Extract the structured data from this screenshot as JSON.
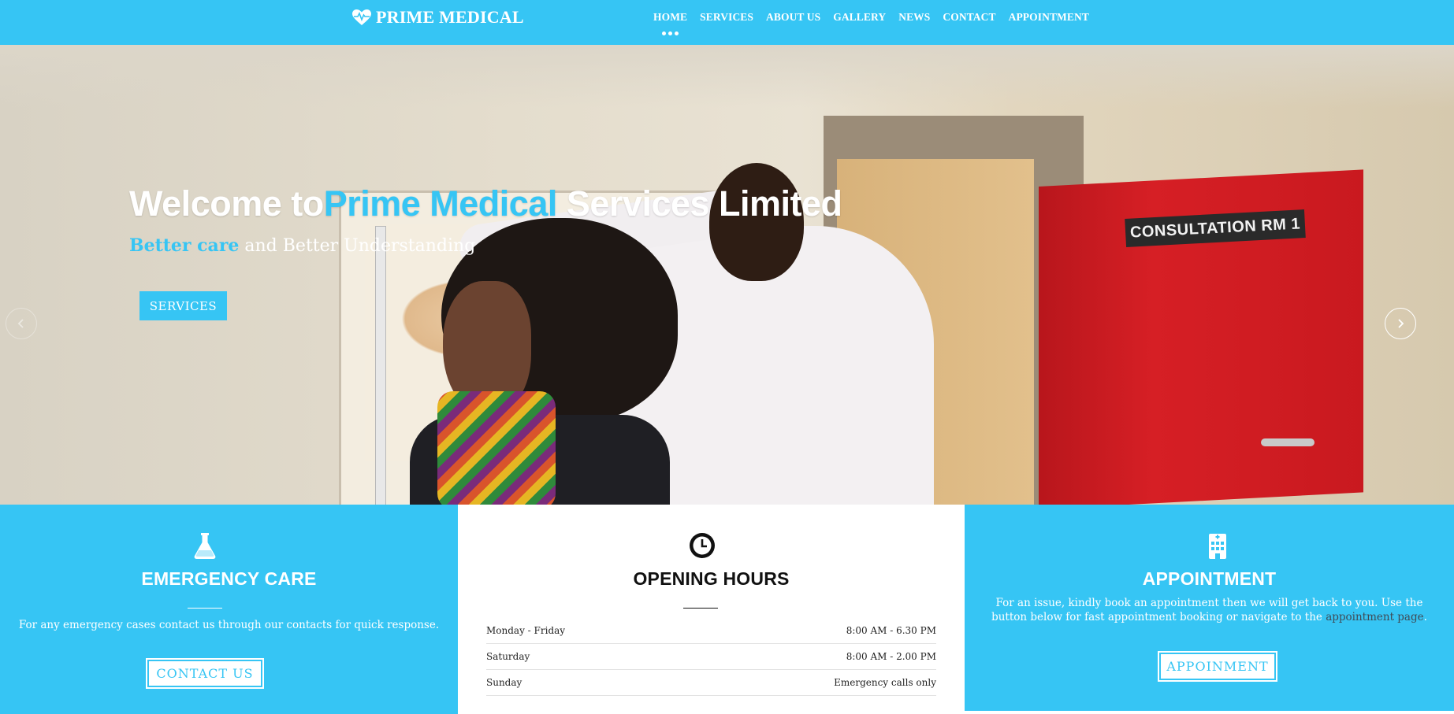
{
  "brand": {
    "name": "PRIME MEDICAL",
    "icon": "heartbeat-icon"
  },
  "nav": {
    "items": [
      "HOME",
      "SERVICES",
      "ABOUT US",
      "GALLERY",
      "NEWS",
      "CONTACT",
      "APPOINTMENT"
    ],
    "active": "HOME"
  },
  "hero": {
    "title_prefix": "Welcome to",
    "title_accent": "Prime Medical",
    "title_suffix": " Services Limited",
    "subtitle_accent": "Better care",
    "subtitle_rest": " and Better Understanding",
    "button": "SERVICES",
    "door_sign": "CONSULTATION RM 1"
  },
  "emergency": {
    "icon": "flask-icon",
    "title": "EMERGENCY CARE",
    "text": "For any emergency cases contact us through our contacts for quick response.",
    "button": "CONTACT US"
  },
  "hours": {
    "icon": "clock-icon",
    "title": "OPENING HOURS",
    "rows": [
      {
        "day": "Monday - Friday",
        "time": "8:00 AM - 6.30 PM"
      },
      {
        "day": "Saturday",
        "time": "8:00 AM - 2.00 PM"
      },
      {
        "day": "Sunday",
        "time": "Emergency calls only"
      }
    ]
  },
  "appointment": {
    "icon": "hospital-icon",
    "title": "APPOINTMENT",
    "text": "For an issue, kindly book an appointment then we will get back to you. Use the button below for fast appointment booking or navigate to the ",
    "link": "appointment page",
    "text_end": ".",
    "button": "APPOINMENT"
  },
  "colors": {
    "accent": "#36c5f4",
    "text_dark": "#111111",
    "white": "#ffffff"
  }
}
